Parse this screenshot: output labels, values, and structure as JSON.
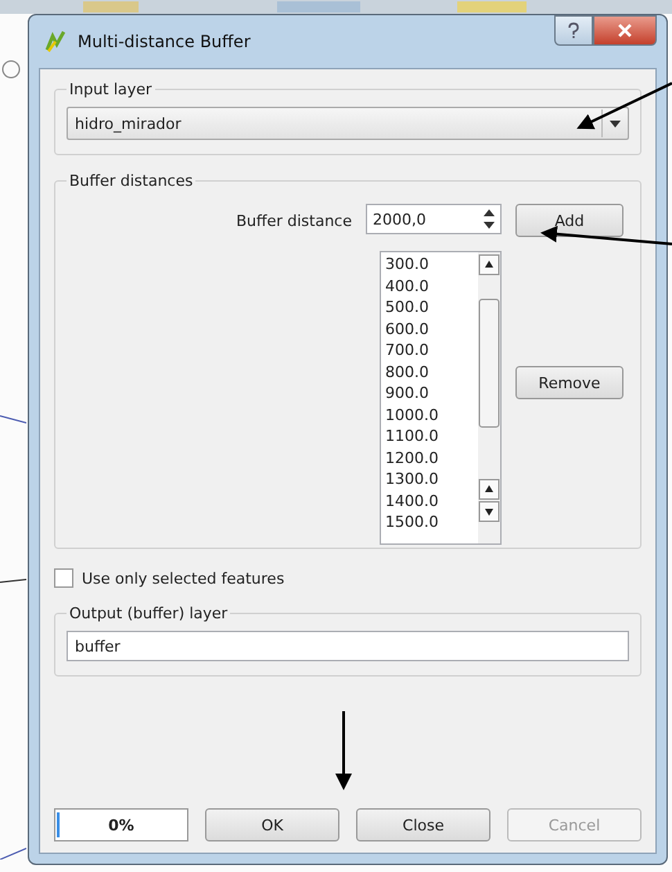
{
  "window": {
    "title": "Multi-distance Buffer"
  },
  "input_layer": {
    "label": "Input layer",
    "value": "hidro_mirador"
  },
  "buffer_distances": {
    "label": "Buffer distances",
    "distance_label": "Buffer distance",
    "distance_value": "2000,0",
    "add_button": "Add",
    "remove_button": "Remove",
    "items": [
      "300.0",
      "400.0",
      "500.0",
      "600.0",
      "700.0",
      "800.0",
      "900.0",
      "1000.0",
      "1100.0",
      "1200.0",
      "1300.0",
      "1400.0",
      "1500.0"
    ]
  },
  "use_selected": {
    "label": "Use only selected features",
    "checked": false
  },
  "output_layer": {
    "label": "Output (buffer) layer",
    "value": "buffer"
  },
  "progress": {
    "level": 0,
    "reading": "0%"
  },
  "buttons": [
    {
      "label": "OK",
      "disabled": false
    },
    {
      "label": "Close",
      "disabled": false
    },
    {
      "label": "Cancel",
      "disabled": true
    }
  ]
}
